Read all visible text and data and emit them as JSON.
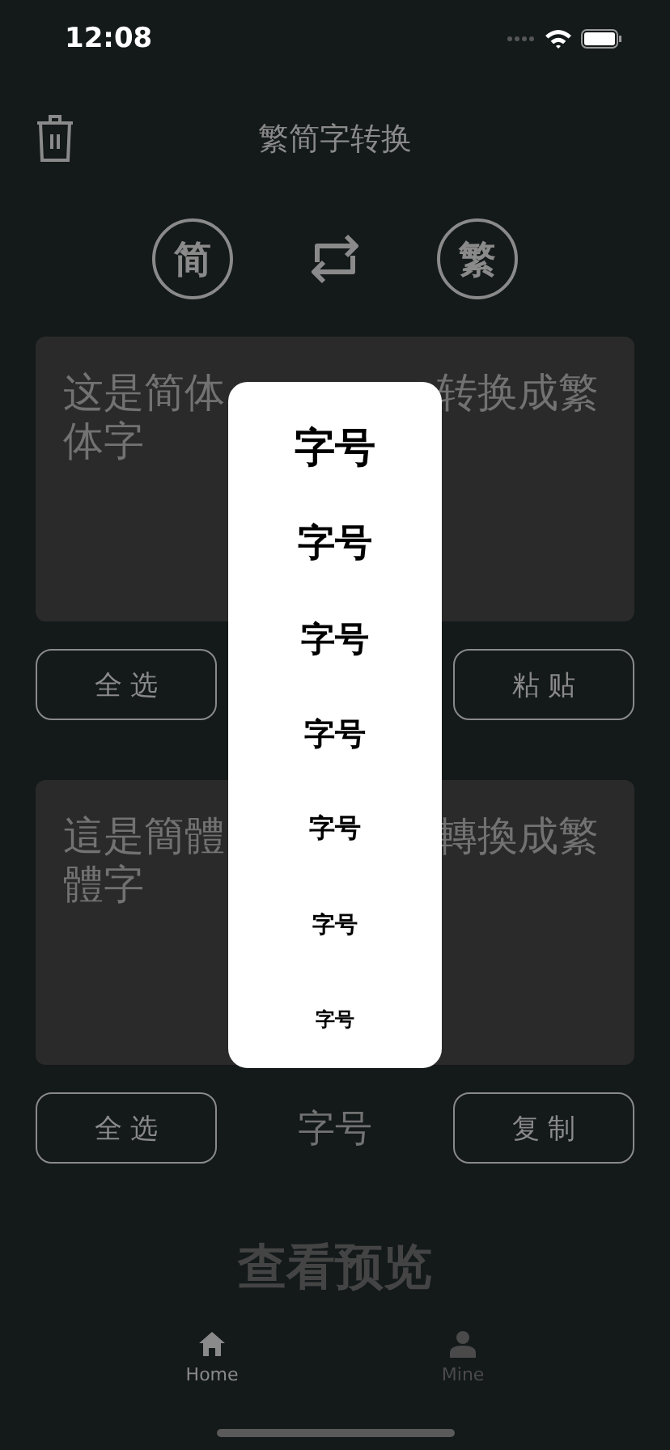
{
  "status_bar": {
    "time": "12:08"
  },
  "header": {
    "title": "繁简字转换"
  },
  "converter": {
    "source": "简",
    "target": "繁"
  },
  "input_box": {
    "lines": [
      [
        "这是简体",
        "转换成繁"
      ],
      [
        "体字"
      ]
    ]
  },
  "input_actions": {
    "left": "全 选",
    "right": "粘 贴"
  },
  "output_box": {
    "lines": [
      [
        "這是簡體",
        "轉換成繁"
      ],
      [
        "體字"
      ]
    ]
  },
  "output_actions": {
    "left": "全 选",
    "middle": "字号",
    "right": "复 制"
  },
  "preview": "查看预览",
  "tabs": [
    {
      "label": "Home",
      "selected": true,
      "kind": "home"
    },
    {
      "label": "Mine",
      "selected": false,
      "kind": "person"
    }
  ],
  "font_size_menu": {
    "items": [
      "字号",
      "字号",
      "字号",
      "字号",
      "字号",
      "字号",
      "字号"
    ]
  }
}
